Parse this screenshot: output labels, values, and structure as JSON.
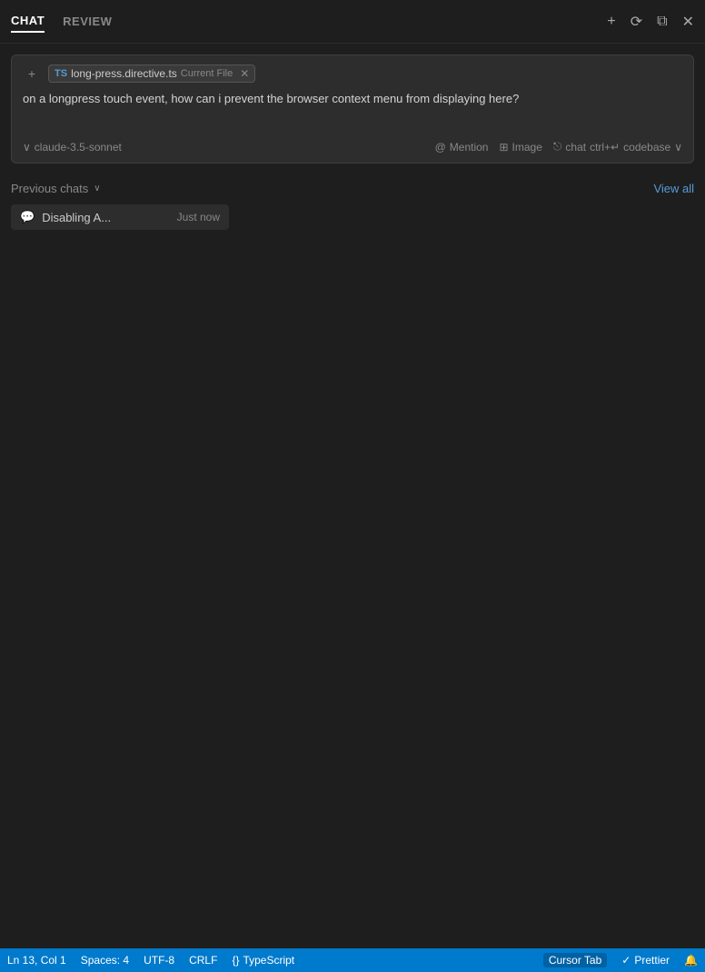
{
  "nav": {
    "tabs": [
      {
        "id": "chat",
        "label": "CHAT",
        "active": true
      },
      {
        "id": "review",
        "label": "REVIEW",
        "active": false
      }
    ],
    "icons": {
      "plus": "+",
      "history": "⟳",
      "split": "⧉",
      "close": "✕"
    }
  },
  "chat_input": {
    "plus_icon": "+",
    "file_tag": {
      "ts_label": "TS",
      "filename": "long-press.directive.ts",
      "badge": "Current File",
      "close": "✕"
    },
    "input_text": "on a longpress touch event, how can i prevent the browser context menu from displaying here?",
    "model": {
      "chevron": "∨",
      "label": "claude-3.5-sonnet"
    },
    "mention_icon": "@",
    "mention_label": "Mention",
    "image_icon": "⊞",
    "image_label": "Image",
    "chat_icon": "⎋",
    "chat_label": "chat",
    "shortcut": "ctrl+↵",
    "codebase_label": "codebase",
    "codebase_chevron": "∨"
  },
  "previous_chats": {
    "title": "Previous chats",
    "chevron": "∨",
    "view_all": "View all",
    "items": [
      {
        "icon": "💬",
        "title": "Disabling A...",
        "time": "Just now"
      }
    ]
  },
  "status_bar": {
    "position": "Ln 13, Col 1",
    "spaces": "Spaces: 4",
    "encoding": "UTF-8",
    "line_ending": "CRLF",
    "language_icon": "{}",
    "language": "TypeScript",
    "cursor_tab": "Cursor Tab",
    "prettier_icon": "✓",
    "prettier": "Prettier",
    "bell_icon": "🔔"
  }
}
